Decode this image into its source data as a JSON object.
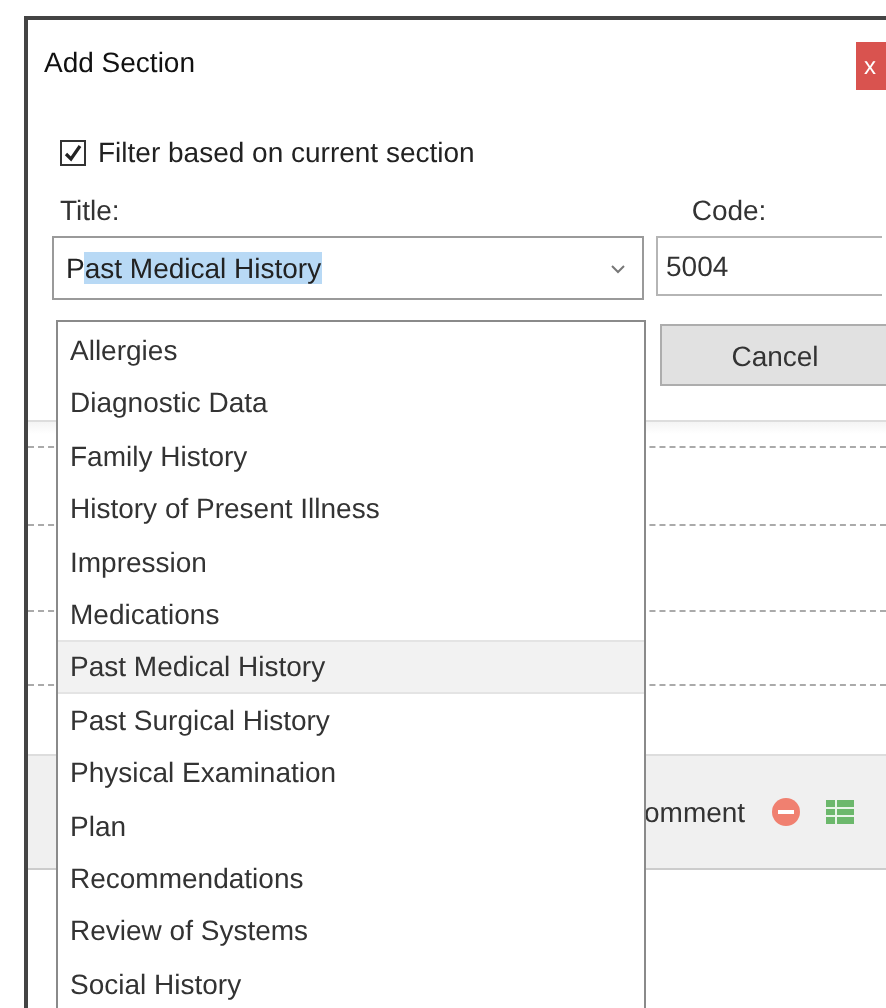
{
  "window": {
    "title": "Add Section",
    "close": "x"
  },
  "filter": {
    "label": "Filter based on current section",
    "checked": true
  },
  "title_field": {
    "label": "Title:",
    "value": "Past Medical History",
    "text_highlighted": true,
    "expanded": true
  },
  "code_field": {
    "label": "Code:",
    "value": "5004"
  },
  "cancel_button": "Cancel",
  "background": {
    "toolbar_text": "omment"
  },
  "dropdown": [
    {
      "label": "Allergies",
      "selected": false
    },
    {
      "label": "Diagnostic Data",
      "selected": false
    },
    {
      "label": "Family History",
      "selected": false
    },
    {
      "label": "History of Present Illness",
      "selected": false
    },
    {
      "label": "Impression",
      "selected": false
    },
    {
      "label": "Medications",
      "selected": false
    },
    {
      "label": "Past Medical History",
      "selected": true
    },
    {
      "label": "Past Surgical History",
      "selected": false
    },
    {
      "label": "Physical Examination",
      "selected": false
    },
    {
      "label": "Plan",
      "selected": false
    },
    {
      "label": "Recommendations",
      "selected": false
    },
    {
      "label": "Review of Systems",
      "selected": false
    },
    {
      "label": "Social History",
      "selected": false
    }
  ]
}
